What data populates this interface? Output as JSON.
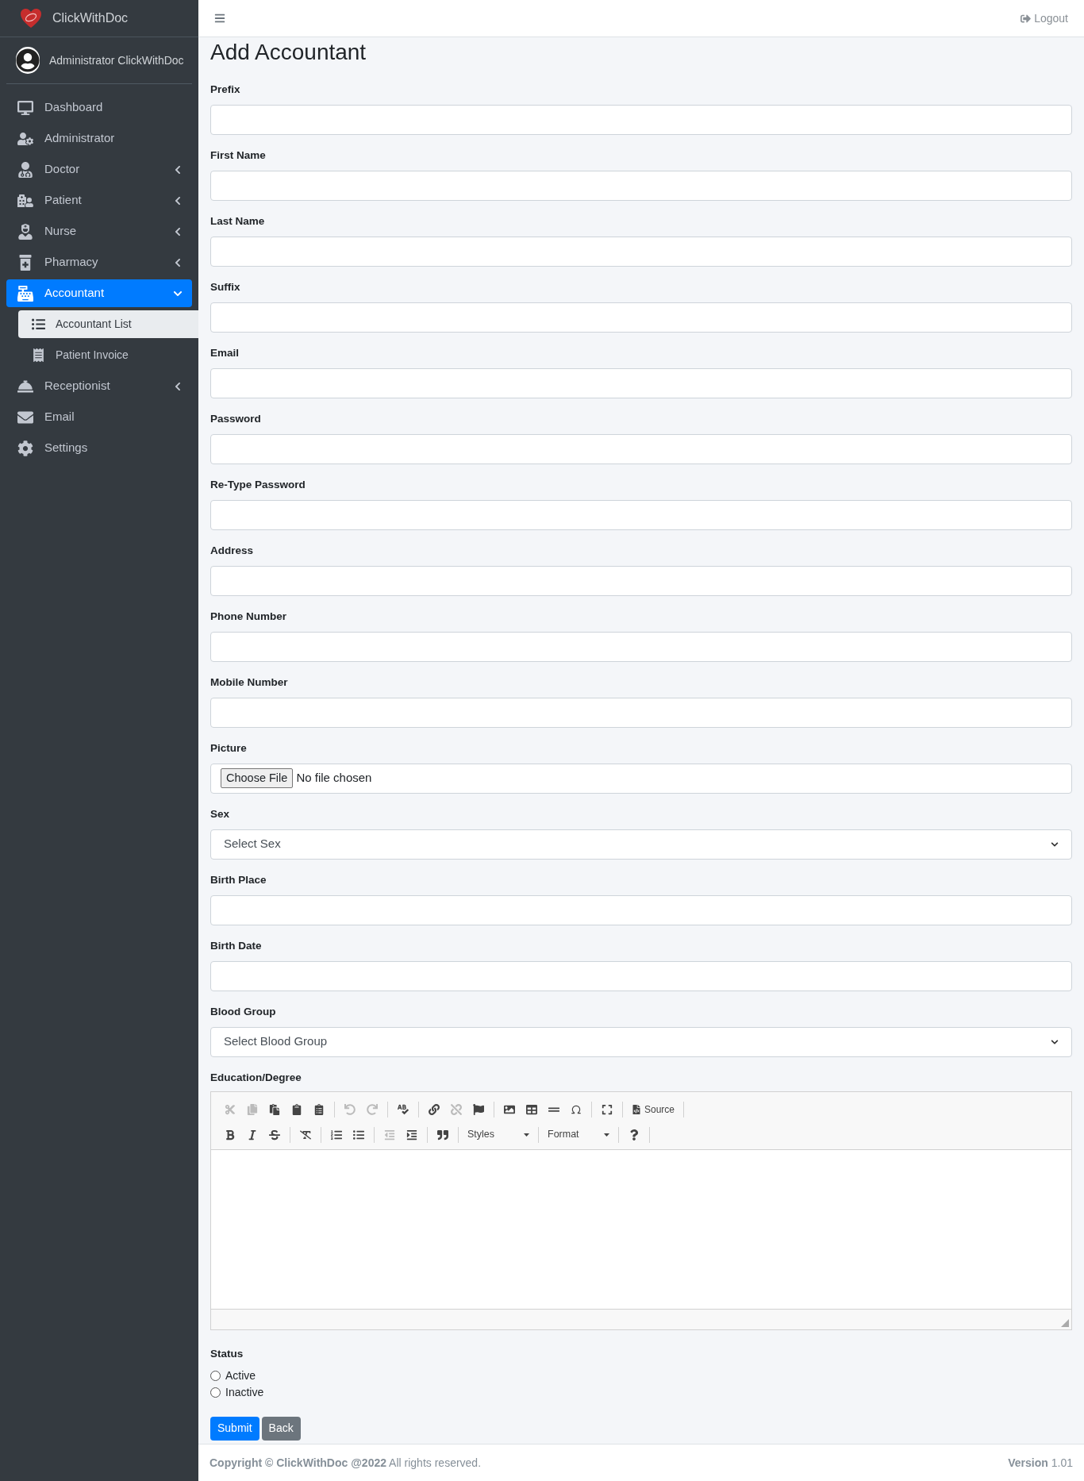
{
  "brand": {
    "name": "ClickWithDoc"
  },
  "user": {
    "name": "Administrator ClickWithDoc"
  },
  "nav": [
    {
      "label": "Dashboard",
      "selected": false
    },
    {
      "label": "Administrator",
      "selected": false
    },
    {
      "label": "Doctor",
      "selected": false,
      "expanded": false
    },
    {
      "label": "Patient",
      "selected": false,
      "expanded": false
    },
    {
      "label": "Nurse",
      "selected": false,
      "expanded": false
    },
    {
      "label": "Pharmacy",
      "selected": false,
      "expanded": false
    },
    {
      "label": "Accountant",
      "selected": true,
      "expanded": true,
      "children": [
        {
          "label": "Accountant List",
          "selected": true
        },
        {
          "label": "Patient Invoice",
          "selected": false
        }
      ]
    },
    {
      "label": "Receptionist",
      "selected": false,
      "expanded": false
    },
    {
      "label": "Email",
      "selected": false
    },
    {
      "label": "Settings",
      "selected": false
    }
  ],
  "topbar": {
    "logout": "Logout"
  },
  "page_title": "Add Accountant",
  "fields": [
    {
      "label": "Prefix",
      "kind": "text"
    },
    {
      "label": "First Name",
      "kind": "text"
    },
    {
      "label": "Last Name",
      "kind": "text"
    },
    {
      "label": "Suffix",
      "kind": "text"
    },
    {
      "label": "Email",
      "kind": "text"
    },
    {
      "label": "Password",
      "kind": "text"
    },
    {
      "label": "Re-Type Password",
      "kind": "text"
    },
    {
      "label": "Address",
      "kind": "text"
    },
    {
      "label": "Phone Number",
      "kind": "text"
    },
    {
      "label": "Mobile Number",
      "kind": "text"
    },
    {
      "label": "Picture",
      "kind": "file",
      "button": "Choose File",
      "value": "No file chosen"
    },
    {
      "label": "Sex",
      "kind": "select",
      "value": "Select Sex"
    },
    {
      "label": "Birth Place",
      "kind": "text"
    },
    {
      "label": "Birth Date",
      "kind": "text"
    },
    {
      "label": "Blood Group",
      "kind": "select",
      "value": "Select Blood Group"
    }
  ],
  "editor": {
    "label": "Education/Degree",
    "toolbar": [
      [
        [
          {
            "disabled": true
          },
          {
            "disabled": true
          },
          {
            "disabled": false
          },
          {
            "disabled": false
          },
          {
            "disabled": false
          }
        ],
        [
          {
            "disabled": true
          },
          {
            "disabled": true
          }
        ],
        [
          {
            "disabled": false
          }
        ],
        [
          {
            "disabled": false
          },
          {
            "disabled": true
          },
          {
            "disabled": false
          }
        ],
        [
          {
            "disabled": false
          },
          {
            "disabled": false
          },
          {
            "disabled": false
          },
          {
            "disabled": false
          }
        ],
        [
          {
            "disabled": false
          }
        ],
        [
          {
            "kind": "text",
            "label": "Source",
            "disabled": false
          }
        ]
      ],
      [
        [
          {
            "disabled": false
          },
          {
            "disabled": false
          },
          {
            "disabled": false
          }
        ],
        [
          {
            "disabled": false
          }
        ],
        [
          {
            "disabled": false
          },
          {
            "disabled": false
          }
        ],
        [
          {
            "disabled": true
          },
          {
            "disabled": false
          }
        ],
        [
          {
            "disabled": false
          }
        ],
        [
          {
            "kind": "dropdown",
            "label": "Styles",
            "disabled": false
          }
        ],
        [
          {
            "kind": "dropdown",
            "label": "Format",
            "disabled": false
          }
        ],
        [
          {
            "disabled": false
          }
        ]
      ]
    ]
  },
  "status": {
    "label": "Status",
    "options": [
      {
        "label": "Active",
        "selected": false
      },
      {
        "label": "Inactive",
        "selected": false
      }
    ]
  },
  "buttons": [
    {
      "label": "Submit",
      "kind": "primary"
    },
    {
      "label": "Back",
      "kind": "secondary"
    }
  ],
  "footer": {
    "copyright": "**Copyright © ClickWithDoc @2022** All rights reserved.",
    "version_label": "Version",
    "version": "1.01"
  }
}
